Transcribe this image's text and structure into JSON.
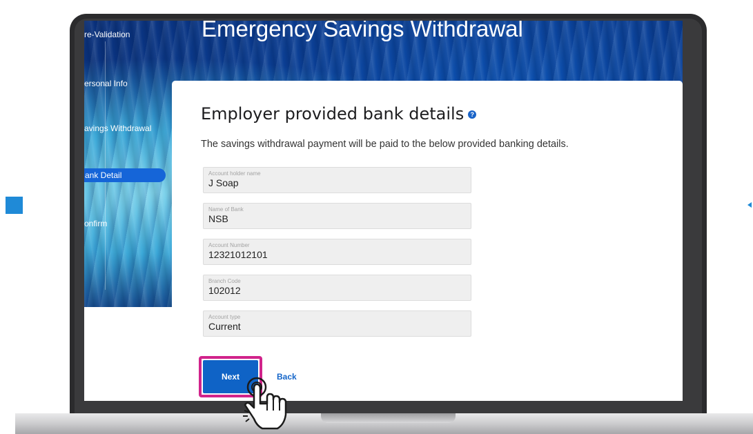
{
  "header": {
    "title": "Emergency Savings Withdrawal"
  },
  "sidebar": {
    "items": [
      {
        "label": "re-Validation"
      },
      {
        "label": "ersonal Info"
      },
      {
        "label": "avings Withdrawal"
      },
      {
        "label": "ank Detail",
        "active": true
      },
      {
        "label": "onfirm"
      }
    ]
  },
  "card": {
    "title": "Employer provided bank details",
    "help_icon": "help-icon",
    "help_glyph": "?",
    "description": "The savings withdrawal payment will be paid to the below provided banking details.",
    "fields": [
      {
        "label": "Account holder name",
        "value": "J Soap"
      },
      {
        "label": "Name of Bank",
        "value": "NSB"
      },
      {
        "label": "Account Number",
        "value": "12321012101"
      },
      {
        "label": "Branch Code",
        "value": "102012"
      },
      {
        "label": "Account type",
        "value": "Current"
      }
    ],
    "next_label": "Next",
    "back_label": "Back"
  },
  "colors": {
    "accent": "#0f63c6",
    "highlight": "#d1238b",
    "hero": "#0c4aa6"
  }
}
